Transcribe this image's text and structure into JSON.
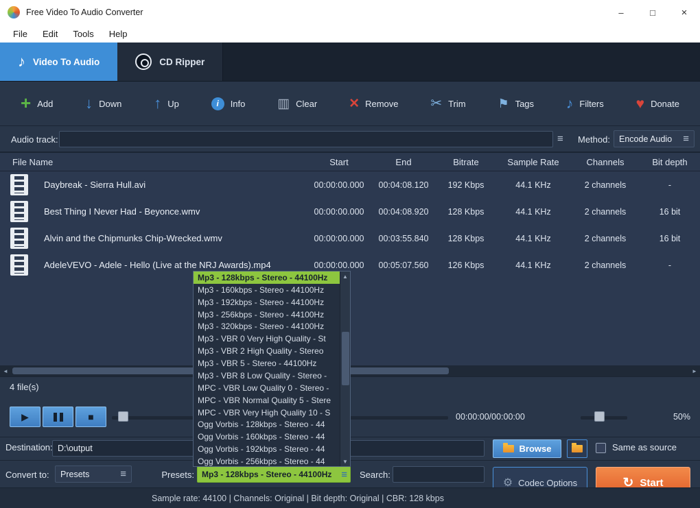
{
  "window": {
    "title": "Free Video To Audio Converter",
    "minimize": "–",
    "maximize": "□",
    "close": "×"
  },
  "menu": {
    "items": [
      "File",
      "Edit",
      "Tools",
      "Help"
    ]
  },
  "tabs": [
    {
      "label": "Video To Audio",
      "icon": "music-note-icon",
      "active": true
    },
    {
      "label": "CD Ripper",
      "icon": "cd-icon",
      "active": false
    }
  ],
  "toolbar": [
    {
      "label": "Add",
      "icon": "add-icon"
    },
    {
      "label": "Down",
      "icon": "down-icon"
    },
    {
      "label": "Up",
      "icon": "up-icon"
    },
    {
      "label": "Info",
      "icon": "info-icon"
    },
    {
      "label": "Clear",
      "icon": "clear-icon"
    },
    {
      "label": "Remove",
      "icon": "remove-icon"
    },
    {
      "label": "Trim",
      "icon": "trim-icon"
    },
    {
      "label": "Tags",
      "icon": "tags-icon"
    },
    {
      "label": "Filters",
      "icon": "filters-icon"
    },
    {
      "label": "Donate",
      "icon": "donate-icon"
    }
  ],
  "audio_track": {
    "label": "Audio track:",
    "value": "",
    "method_label": "Method:",
    "method_value": "Encode Audio"
  },
  "file_table": {
    "columns": [
      "File Name",
      "Start",
      "End",
      "Bitrate",
      "Sample Rate",
      "Channels",
      "Bit depth"
    ],
    "rows": [
      {
        "name": "Daybreak - Sierra Hull.avi",
        "start": "00:00:00.000",
        "end": "00:04:08.120",
        "bitrate": "192 Kbps",
        "sample_rate": "44.1 KHz",
        "channels": "2 channels",
        "bit_depth": "-"
      },
      {
        "name": "Best Thing I Never Had - Beyonce.wmv",
        "start": "00:00:00.000",
        "end": "00:04:08.920",
        "bitrate": "128 Kbps",
        "sample_rate": "44.1 KHz",
        "channels": "2 channels",
        "bit_depth": "16 bit"
      },
      {
        "name": "Alvin and the Chipmunks Chip-Wrecked.wmv",
        "start": "00:00:00.000",
        "end": "00:03:55.840",
        "bitrate": "128 Kbps",
        "sample_rate": "44.1 KHz",
        "channels": "2 channels",
        "bit_depth": "16 bit"
      },
      {
        "name": "AdeleVEVO - Adele - Hello (Live at the NRJ Awards).mp4",
        "start": "00:00:00.000",
        "end": "00:05:07.560",
        "bitrate": "126 Kbps",
        "sample_rate": "44.1 KHz",
        "channels": "2 channels",
        "bit_depth": "-"
      }
    ]
  },
  "preset_dropdown": {
    "selected_index": 0,
    "items": [
      "Mp3 - 128kbps - Stereo - 44100Hz",
      "Mp3 - 160kbps - Stereo - 44100Hz",
      "Mp3 - 192kbps - Stereo - 44100Hz",
      "Mp3 - 256kbps - Stereo - 44100Hz",
      "Mp3 - 320kbps - Stereo - 44100Hz",
      "Mp3 - VBR 0 Very High Quality - St",
      "Mp3 - VBR 2 High Quality - Stereo",
      "Mp3 - VBR 5 - Stereo - 44100Hz",
      "Mp3 - VBR 8 Low Quality - Stereo -",
      "MPC - VBR Low Quality 0 - Stereo -",
      "MPC - VBR Normal Quality 5 - Stere",
      "MPC - VBR Very High Quality 10 - S",
      "Ogg Vorbis - 128kbps - Stereo - 44",
      "Ogg Vorbis - 160kbps - Stereo - 44",
      "Ogg Vorbis - 192kbps - Stereo - 44",
      "Ogg Vorbis - 256kbps - Stereo - 44"
    ]
  },
  "file_count": "4 file(s)",
  "player": {
    "time": "00:00:00/00:00:00",
    "volume": "50%"
  },
  "destination": {
    "label": "Destination:",
    "value": "D:\\output",
    "browse_label": "Browse",
    "same_as_source": "Same as source"
  },
  "convert_bar": {
    "convert_to_label": "Convert to:",
    "convert_to_value": "Presets",
    "presets_label": "Presets:",
    "presets_value": "Mp3 - 128kbps - Stereo - 44100Hz",
    "search_label": "Search:",
    "search_value": "",
    "codec_options_label": "Codec Options",
    "start_label": "Start"
  },
  "status_bar": "Sample rate: 44100 | Channels: Original | Bit depth: Original | CBR: 128 kbps",
  "colors": {
    "accent_blue": "#3e8ed7",
    "accent_green": "#8dc63f",
    "accent_orange": "#e0592b",
    "accent_red": "#d9453a"
  },
  "icon_glyphs": {
    "add-icon": "+",
    "down-icon": "↓",
    "up-icon": "↑",
    "info-icon": "i",
    "clear-icon": "▥",
    "remove-icon": "×",
    "trim-icon": "✂",
    "tags-icon": "⚑",
    "filters-icon": "♪",
    "donate-icon": "♥",
    "music-note-icon": "♪",
    "play-icon": "▶",
    "stop-icon": "■",
    "menu-icon": "≡",
    "gear-icon": "⚙",
    "refresh-icon": "↻",
    "scroll-left-icon": "◄",
    "scroll-right-icon": "►",
    "scroll-up-icon": "▲",
    "scroll-down-icon": "▼"
  }
}
